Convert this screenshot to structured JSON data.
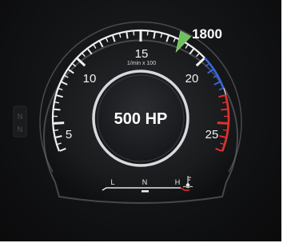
{
  "gauge": {
    "type": "tachometer",
    "scale_labels": [
      "5",
      "10",
      "15",
      "20",
      "25"
    ],
    "unit": "1/min x 100",
    "pointer_value": 18,
    "pointer_readout": "1800",
    "center_display": "500 HP",
    "colors": {
      "scale": "#f0f0f0",
      "blue_zone": "#3a66e0",
      "red_zone": "#e03030",
      "pointer": "#6ec05c"
    }
  },
  "temperature_gauge": {
    "labels": [
      "L",
      "N",
      "H"
    ],
    "icon": "coolant-temperature-icon",
    "level": "N"
  },
  "side_indicators": [
    "N",
    "N"
  ]
}
